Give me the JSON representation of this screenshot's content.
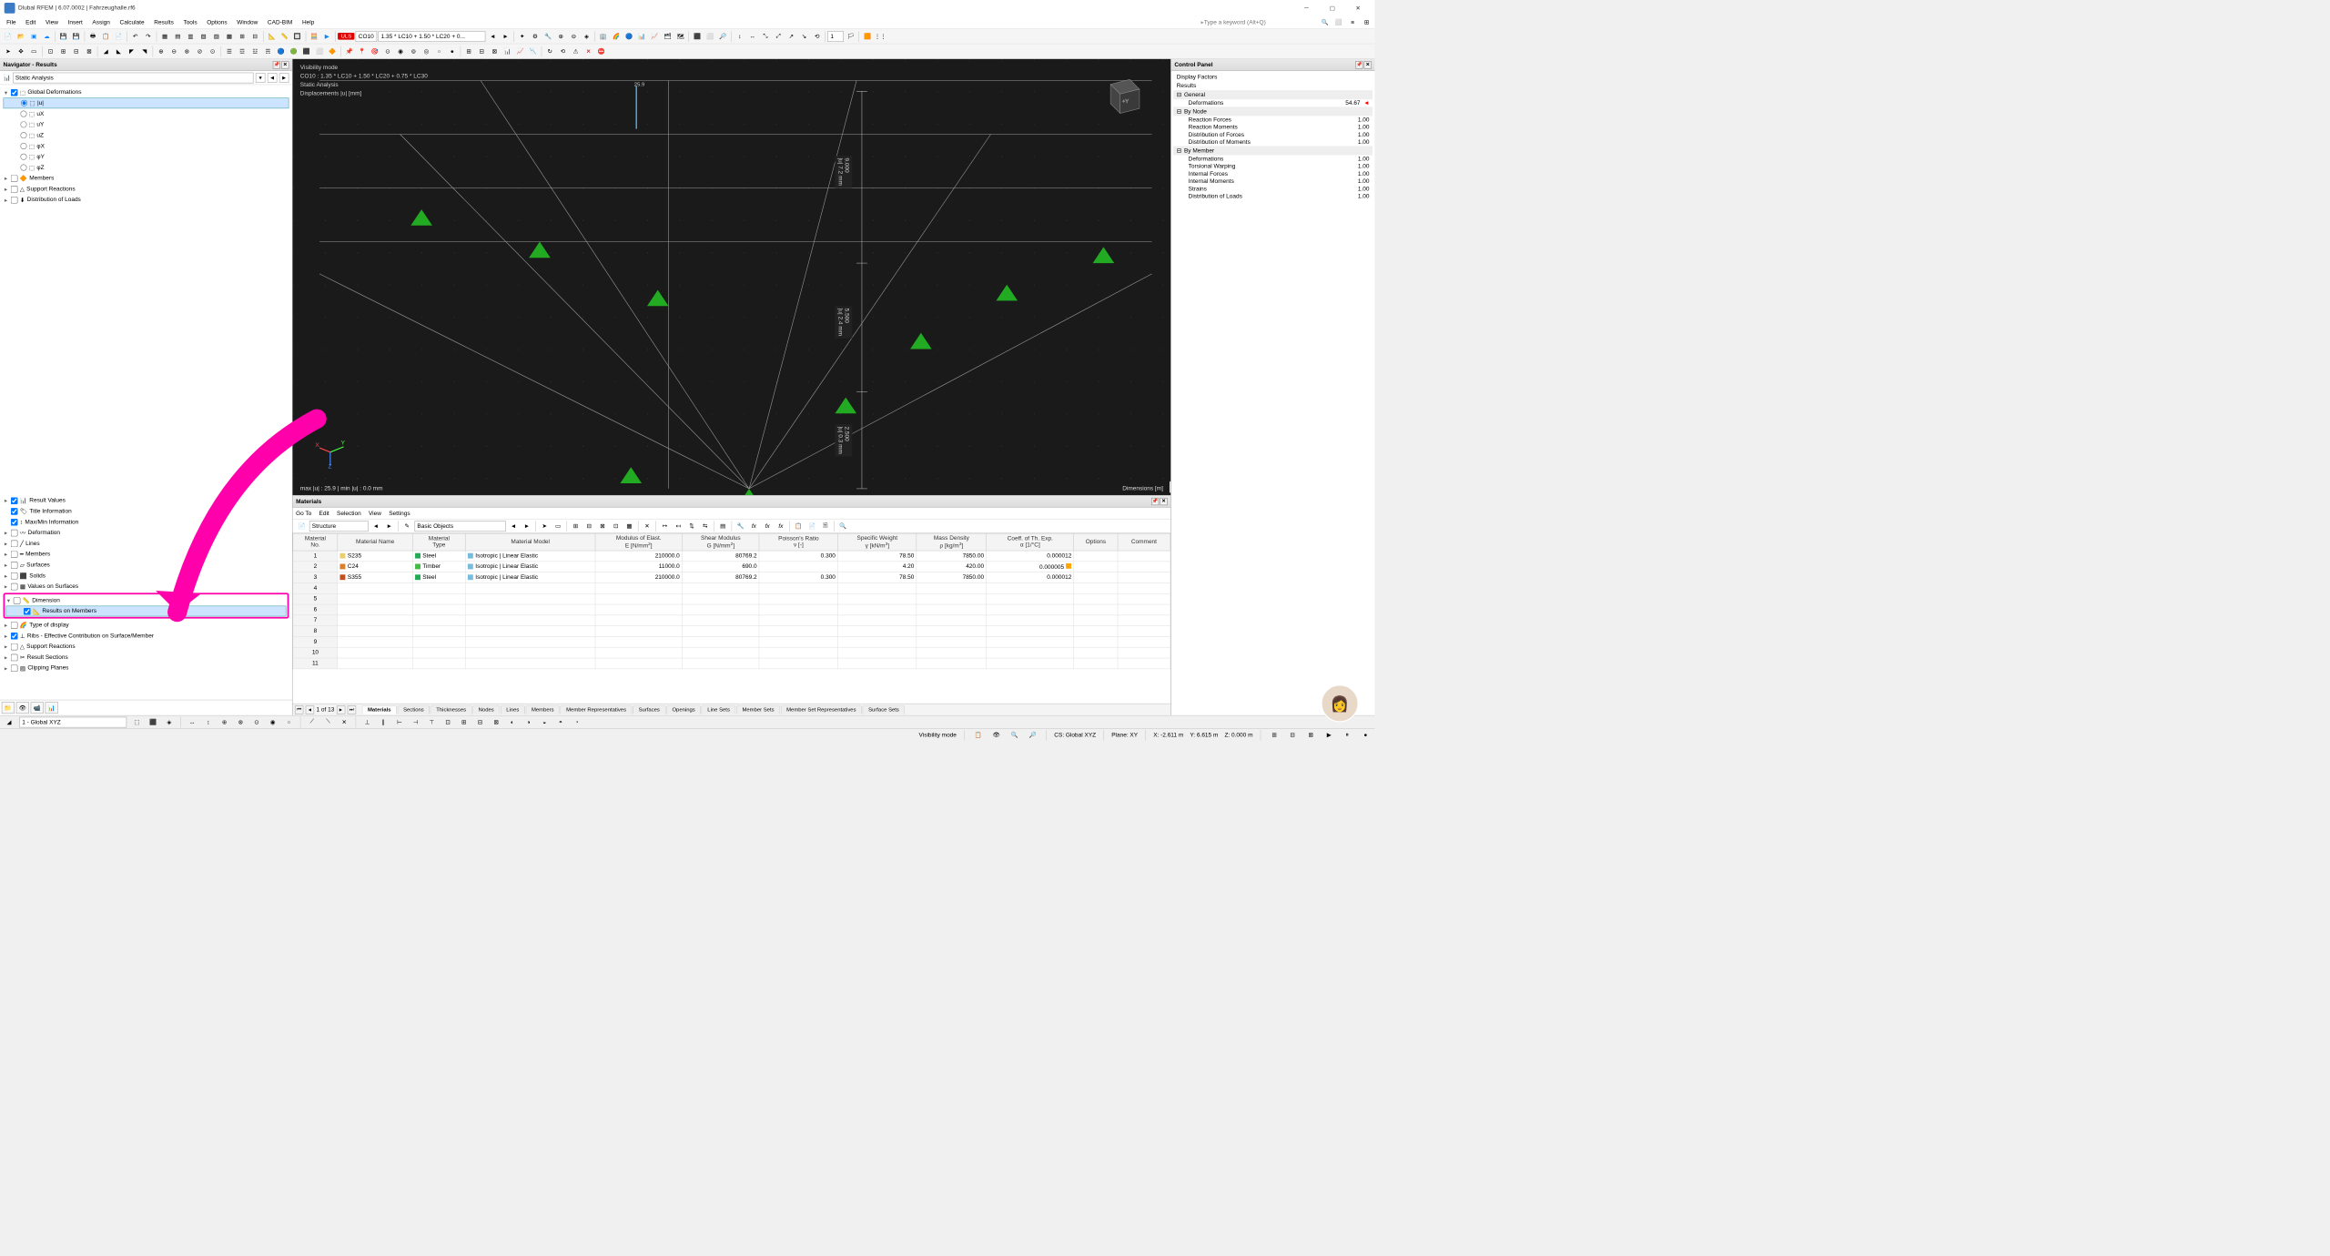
{
  "app": {
    "title": "Dlubal RFEM | 6.07.0002 | Fahrzeughalle.rf6"
  },
  "menu": [
    "File",
    "Edit",
    "View",
    "Insert",
    "Assign",
    "Calculate",
    "Results",
    "Tools",
    "Options",
    "Window",
    "CAD-BIM",
    "Help"
  ],
  "search": {
    "placeholder": "Type a keyword (Alt+Q)"
  },
  "toolbar": {
    "uls": "ULS",
    "co": "CO10",
    "co_desc": "1.35 * LC10 + 1.50 * LC20 + 0..."
  },
  "navigator": {
    "title": "Navigator - Results",
    "select": "Static Analysis",
    "root": "Global Deformations",
    "options": [
      "|u|",
      "uX",
      "uY",
      "uZ",
      "φX",
      "φY",
      "φZ"
    ],
    "groups": [
      "Members",
      "Support Reactions",
      "Distribution of Loads"
    ],
    "bottom": [
      "Result Values",
      "Title Information",
      "Max/Min Information",
      "Deformation",
      "Lines",
      "Members",
      "Surfaces",
      "Solids",
      "Values on Surfaces",
      "Dimension",
      "Results on Members",
      "Type of display",
      "Ribs - Effective Contribution on Surface/Member",
      "Support Reactions",
      "Result Sections",
      "Clipping Planes"
    ]
  },
  "viewport": {
    "line1": "Visibility mode",
    "line2": "CO10 : 1.35 * LC10 + 1.50 * LC20 + 0.75 * LC30",
    "line3": "Static Analysis",
    "line4": "Displacements |u| [mm]",
    "footer": "max |u| : 25.9 | min |u| : 0.0 mm",
    "dims": "Dimensions [m]",
    "dim3": "25.9",
    "dim_a": {
      "h": "9.000",
      "u": "|u| 7.2 mm"
    },
    "dim_b": {
      "h": "5.500",
      "u": "|u| 2.4 mm"
    },
    "dim_c": {
      "h": "2.500",
      "u": "|u| 0.3 mm"
    }
  },
  "control": {
    "title": "Control Panel",
    "sub1": "Display Factors",
    "sub2": "Results",
    "sections": [
      {
        "name": "General",
        "rows": [
          {
            "lbl": "Deformations",
            "val": "54.67",
            "flag": true
          }
        ]
      },
      {
        "name": "By Node",
        "rows": [
          {
            "lbl": "Reaction Forces",
            "val": "1.00"
          },
          {
            "lbl": "Reaction Moments",
            "val": "1.00"
          },
          {
            "lbl": "Distribution of Forces",
            "val": "1.00"
          },
          {
            "lbl": "Distribution of Moments",
            "val": "1.00"
          }
        ]
      },
      {
        "name": "By Member",
        "rows": [
          {
            "lbl": "Deformations",
            "val": "1.00"
          },
          {
            "lbl": "Torsional Warping",
            "val": "1.00"
          },
          {
            "lbl": "Internal Forces",
            "val": "1.00"
          },
          {
            "lbl": "Internal Moments",
            "val": "1.00"
          },
          {
            "lbl": "Strains",
            "val": "1.00"
          },
          {
            "lbl": "Distribution of Loads",
            "val": "1.00"
          }
        ]
      }
    ]
  },
  "materials": {
    "title": "Materials",
    "menu": [
      "Go To",
      "Edit",
      "Selection",
      "View",
      "Settings"
    ],
    "tool": {
      "sel": "Structure",
      "basic": "Basic Objects"
    },
    "columns": [
      "Material\nNo.",
      "Material Name",
      "Material\nType",
      "Material Model",
      "Modulus of Elast.\nE [N/mm²]",
      "Shear Modulus\nG [N/mm²]",
      "Poisson's Ratio\nν [-]",
      "Specific Weight\nγ [kN/m³]",
      "Mass Density\nρ [kg/m³]",
      "Coeff. of Th. Exp.\nα [1/°C]",
      "Options",
      "Comment"
    ],
    "rows": [
      {
        "no": "1",
        "name": "S235",
        "color": "#e8d070",
        "type": "Steel",
        "tcolor": "#2a5",
        "model": "Isotropic | Linear Elastic",
        "mcolor": "#7bd",
        "E": "210000.0",
        "G": "80769.2",
        "v": "0.300",
        "gamma": "78.50",
        "rho": "7850.00",
        "alpha": "0.000012",
        "warn": false
      },
      {
        "no": "2",
        "name": "C24",
        "color": "#d88030",
        "type": "Timber",
        "tcolor": "#4b4",
        "model": "Isotropic | Linear Elastic",
        "mcolor": "#7bd",
        "E": "11000.0",
        "G": "690.0",
        "v": "",
        "gamma": "4.20",
        "rho": "420.00",
        "alpha": "0.000005",
        "warn": true
      },
      {
        "no": "3",
        "name": "S355",
        "color": "#c05020",
        "type": "Steel",
        "tcolor": "#2a5",
        "model": "Isotropic | Linear Elastic",
        "mcolor": "#7bd",
        "E": "210000.0",
        "G": "80769.2",
        "v": "0.300",
        "gamma": "78.50",
        "rho": "7850.00",
        "alpha": "0.000012",
        "warn": false
      }
    ],
    "pager": "1 of 13",
    "tabs": [
      "Materials",
      "Sections",
      "Thicknesses",
      "Nodes",
      "Lines",
      "Members",
      "Member Representatives",
      "Surfaces",
      "Openings",
      "Line Sets",
      "Member Sets",
      "Member Set Representatives",
      "Surface Sets"
    ]
  },
  "coordbar": {
    "cs": "1 - Global XYZ"
  },
  "status": {
    "mode": "Visibility mode",
    "cs": "CS: Global XYZ",
    "plane": "Plane: XY",
    "x": "X: -2.611 m",
    "y": "Y: 6.615 m",
    "z": "Z: 0.000 m"
  }
}
